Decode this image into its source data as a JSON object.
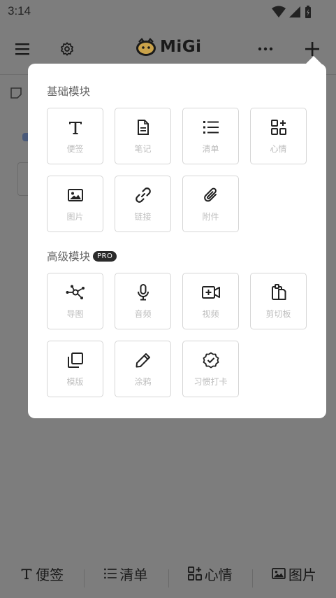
{
  "status_bar": {
    "time": "3:14"
  },
  "app_bar": {
    "logo_text": "MiGi"
  },
  "popup": {
    "basic_section_title": "基础模块",
    "advanced_section_title": "高级模块",
    "pro_badge": "PRO",
    "basic_modules": [
      {
        "label": "便签",
        "icon": "text-icon"
      },
      {
        "label": "笔记",
        "icon": "document-icon"
      },
      {
        "label": "清单",
        "icon": "list-icon"
      },
      {
        "label": "心情",
        "icon": "mood-icon"
      },
      {
        "label": "图片",
        "icon": "image-icon"
      },
      {
        "label": "链接",
        "icon": "link-icon"
      },
      {
        "label": "附件",
        "icon": "paperclip-icon"
      }
    ],
    "advanced_modules": [
      {
        "label": "导图",
        "icon": "mindmap-icon"
      },
      {
        "label": "音频",
        "icon": "microphone-icon"
      },
      {
        "label": "视频",
        "icon": "video-icon"
      },
      {
        "label": "剪切板",
        "icon": "clipboard-icon"
      },
      {
        "label": "模版",
        "icon": "template-icon"
      },
      {
        "label": "涂鸦",
        "icon": "pencil-icon"
      },
      {
        "label": "习惯打卡",
        "icon": "check-badge-icon"
      }
    ]
  },
  "bottom_bar": [
    {
      "label": "便签",
      "icon": "text-icon"
    },
    {
      "label": "清单",
      "icon": "list-icon"
    },
    {
      "label": "心情",
      "icon": "mood-icon"
    },
    {
      "label": "图片",
      "icon": "image-icon"
    }
  ]
}
